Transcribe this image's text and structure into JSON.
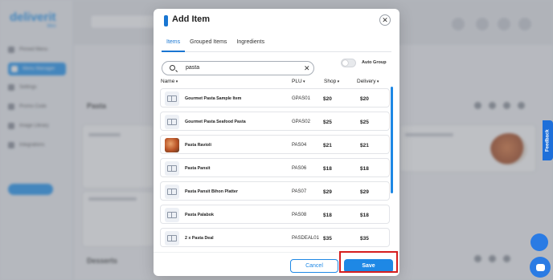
{
  "background": {
    "logo": "deliverit",
    "logo_sub": "Mini",
    "sidebar_items": [
      "Pinned Menu",
      "Menu Manager",
      "Settings",
      "Promo Code",
      "Image Library",
      "Integrations"
    ],
    "section_heading_1": "Pasta",
    "section_heading_2": "Desserts"
  },
  "modal": {
    "title": "Add Item",
    "tabs": [
      {
        "label": "Items",
        "active": true
      },
      {
        "label": "Grouped Items",
        "active": false
      },
      {
        "label": "Ingredients",
        "active": false
      }
    ],
    "search": {
      "value": "pasta",
      "clear_icon": "close-icon"
    },
    "auto_group": {
      "label": "Auto Group",
      "on": false
    },
    "columns": {
      "name": "Name",
      "plu": "PLU",
      "shop": "Shop",
      "delivery": "Delivery"
    },
    "rows": [
      {
        "name": "Gourmet Pasta Sample Item",
        "plu": "GPAS01",
        "shop": "$20",
        "delivery": "$20",
        "image": "placeholder-icon"
      },
      {
        "name": "Gourmet Pasta Seafood Pasta",
        "plu": "GPAS02",
        "shop": "$25",
        "delivery": "$25",
        "image": "placeholder-icon"
      },
      {
        "name": "Pasta Ravioli",
        "plu": "PAS04",
        "shop": "$21",
        "delivery": "$21",
        "image": "food-photo"
      },
      {
        "name": "Pasta Pansit",
        "plu": "PAS06",
        "shop": "$18",
        "delivery": "$18",
        "image": "placeholder-icon"
      },
      {
        "name": "Pasta Pansit Bihon Platter",
        "plu": "PAS07",
        "shop": "$29",
        "delivery": "$29",
        "image": "placeholder-icon"
      },
      {
        "name": "Pasta Palabok",
        "plu": "PAS08",
        "shop": "$18",
        "delivery": "$18",
        "image": "placeholder-icon"
      },
      {
        "name": "2 x Pasta Deal",
        "plu": "PASDEAL01",
        "shop": "$35",
        "delivery": "$35",
        "image": "placeholder-icon"
      }
    ],
    "cancel_label": "Cancel",
    "save_label": "Save"
  },
  "feedback_label": "Feedback",
  "colors": {
    "accent": "#1e88e5",
    "highlight": "#d61e1e"
  }
}
